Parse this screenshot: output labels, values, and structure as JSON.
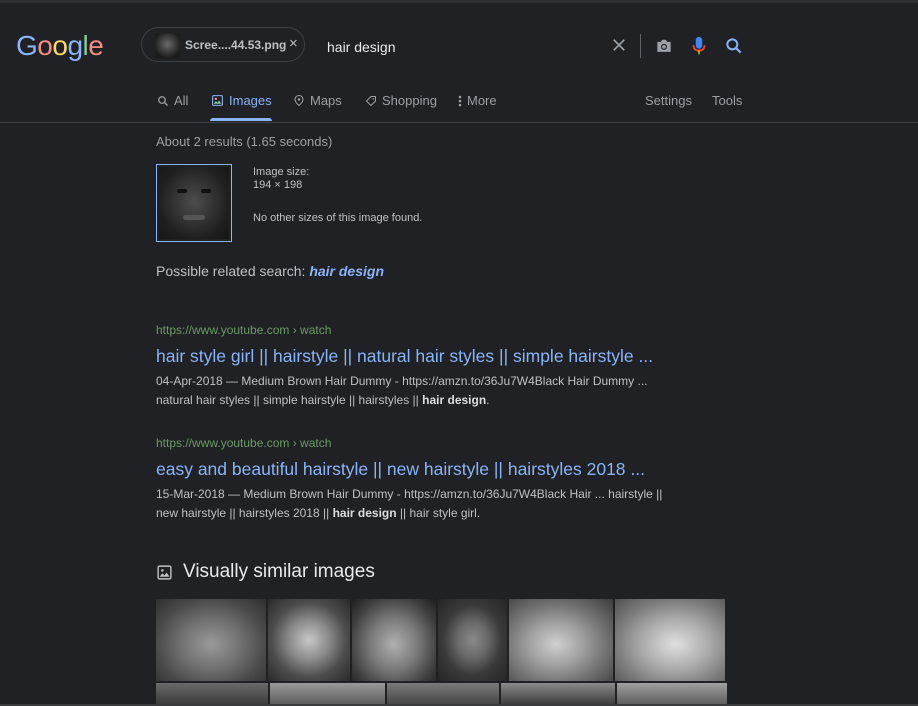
{
  "logo": {
    "letters": [
      "G",
      "o",
      "o",
      "g",
      "l",
      "e"
    ],
    "colors": [
      "#8ab4f8",
      "#f28b82",
      "#fdd663",
      "#8ab4f8",
      "#81c995",
      "#f28b82"
    ]
  },
  "search": {
    "chip_filename": "Scree....44.53.png",
    "chip_close": "×",
    "query": "hair design"
  },
  "tabs": {
    "all": "All",
    "images": "Images",
    "maps": "Maps",
    "shopping": "Shopping",
    "more": "More",
    "settings": "Settings",
    "tools": "Tools"
  },
  "results": {
    "stats": "About 2 results (1.65 seconds)",
    "image_size_label": "Image size:",
    "image_size_value": "194 × 198",
    "no_other_sizes": "No other sizes of this image found.",
    "related_prefix": "Possible related search: ",
    "related_link": "hair design",
    "items": [
      {
        "url": "https://www.youtube.com › watch",
        "title": "hair style girl || hairstyle || natural hair styles || simple hairstyle ...",
        "snippet_line1": "04-Apr-2018 — Medium Brown Hair Dummy - https://amzn.to/36Ju7W4Black Hair Dummy ...",
        "snippet_line2_pre": "natural hair styles || simple hairstyle || hairstyles || ",
        "snippet_line2_bold": "hair design",
        "snippet_line2_post": "."
      },
      {
        "url": "https://www.youtube.com › watch",
        "title": "easy and beautiful hairstyle || new hairstyle || hairstyles 2018 ...",
        "snippet_line1": "15-Mar-2018 — Medium Brown Hair Dummy - https://amzn.to/36Ju7W4Black Hair ... hairstyle ||",
        "snippet_line2_pre": "new hairstyle || hairstyles 2018 || ",
        "snippet_line2_bold": "hair design",
        "snippet_line2_post": " || hair style girl."
      }
    ]
  },
  "similar": {
    "title": "Visually similar images",
    "icon": "image-icon"
  },
  "colors": {
    "background": "#202124",
    "link": "#8ab4f8",
    "url_green": "#6b9a66",
    "text": "#bdc1c6"
  }
}
